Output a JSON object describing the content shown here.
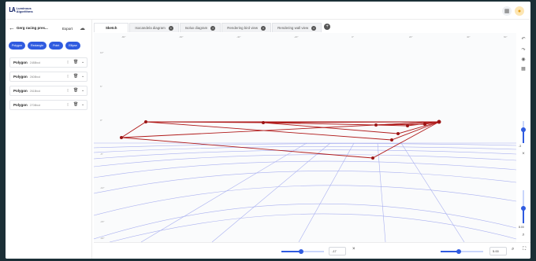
{
  "header": {
    "logo_mark": "LA",
    "logo_line1": "Luminous",
    "logo_line2": "Algorithms",
    "icons": [
      "grid-icon",
      "user-icon"
    ]
  },
  "sidebar": {
    "project_name": "Gerg racing pres...",
    "export_label": "Export",
    "tools": [
      "Polygon",
      "Rectangle",
      "Point",
      "Ellipse"
    ],
    "polygons": [
      {
        "label": "Polygon",
        "id": "2488bcd"
      },
      {
        "label": "Polygon",
        "id": "2608bcd"
      },
      {
        "label": "Polygon",
        "id": "2618bcd"
      },
      {
        "label": "Polygon",
        "id": "2708bcd"
      }
    ]
  },
  "tabs": [
    {
      "label": "Sketch",
      "active": true
    },
    {
      "label": "Isocandela diagram",
      "active": false
    },
    {
      "label": "Isolux diagram",
      "active": false
    },
    {
      "label": "Rendering bird view",
      "active": false
    },
    {
      "label": "Rendering wall view",
      "active": false
    }
  ],
  "canvas": {
    "top_ticks": [
      "-80°",
      "-60°",
      "-40°",
      "-20°",
      "0°",
      "20°",
      "40°",
      "60°"
    ],
    "left_ticks": [
      "10°",
      "5°",
      "0°",
      "-5°",
      "-10°",
      "-15°",
      "-20°"
    ],
    "polygon_color": "#b01a1a",
    "grid_color": "#a9b0f0"
  },
  "right_tools": {
    "zoom_value": "-3",
    "scale_value": "8.00"
  },
  "bottom": {
    "left_value": "-17",
    "right_value": "5.00"
  }
}
